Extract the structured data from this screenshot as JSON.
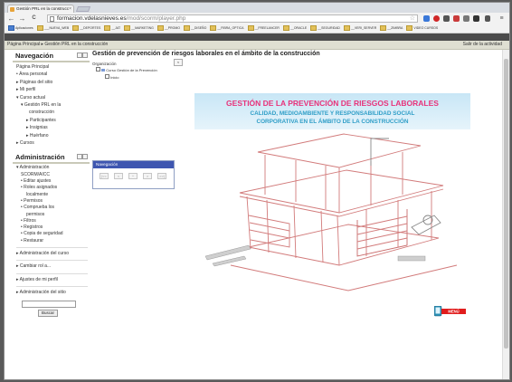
{
  "browser": {
    "tab_title": "Gestión PRL en la construcc",
    "tab_close": "×",
    "url_host": "formacion.vdelasnieves.es",
    "url_path": "/mod/scorm/player.php",
    "back": "←",
    "forward": "→",
    "reload": "C",
    "star": "☆"
  },
  "bookmarks": [
    "Aplicaciones",
    "___NUEVA_WEB",
    "__DEPORTES",
    "__JAT",
    "__MARKETING",
    "__PROMO",
    "__DISEÑO",
    "__FIBRA_OPTICA",
    "__FREELANCER",
    "__ORACLE",
    "__SEGURIDAD",
    "__VERI_SERVER",
    "__ZIMBRA",
    "VIDEO CURSOS"
  ],
  "page": {
    "breadcrumb": "Página Principal ▸ Gestión PRL en la construcción",
    "exit_link": "Salir de la actividad",
    "sco_title": "Gestión de prevención de riesgos laborales en el ámbito de la construcción"
  },
  "nav_block": {
    "title": "Navegación",
    "items": [
      "Página Principal",
      "Área personal",
      "Páginas del sitio",
      "Mi perfil",
      "Curso actual",
      "Gestión PRL en la",
      "construcción",
      "Participantes",
      "Insignias",
      "Huérfano",
      "Cursos"
    ]
  },
  "admin_block": {
    "title": "Administración",
    "items": [
      "Administración",
      "SCORM/AICC",
      "Editar ajustes",
      "Roles asignados",
      "localmente",
      "Permisos",
      "Comprueba los",
      "permisos",
      "Filtros",
      "Registros",
      "Copia de seguridad",
      "Restaurar",
      "Administración del curso",
      "Cambiar rol a...",
      "Ajustes de mi perfil",
      "Administración del sitio"
    ],
    "search_button": "Buscar"
  },
  "toc": {
    "label": "Organización",
    "collapse": "<",
    "course_item": "Curso Gestión de la Prevención",
    "sub_item": "Inicio"
  },
  "navwin": {
    "title": "Navegación",
    "buttons": [
      "|<<",
      "<",
      "^",
      ">",
      ">>|"
    ]
  },
  "banner": {
    "line1": "GESTIÓN DE LA PREVENCIÓN DE RIESGOS LABORALES",
    "line2": "CALIDAD, MEDIOAMBIENTE Y RESPONSABILIDAD SOCIAL",
    "line3": "CORPORATIVA EN EL ÁMBITO DE LA CONSTRUCCIÓN"
  },
  "menu_button": "MENÚ",
  "colors": {
    "banner_text": "#e8327a",
    "banner_sub": "#2f9ec7",
    "nav_header": "#3e56b0",
    "menu_red": "#e11d1d",
    "building_line": "#d27b7b"
  }
}
